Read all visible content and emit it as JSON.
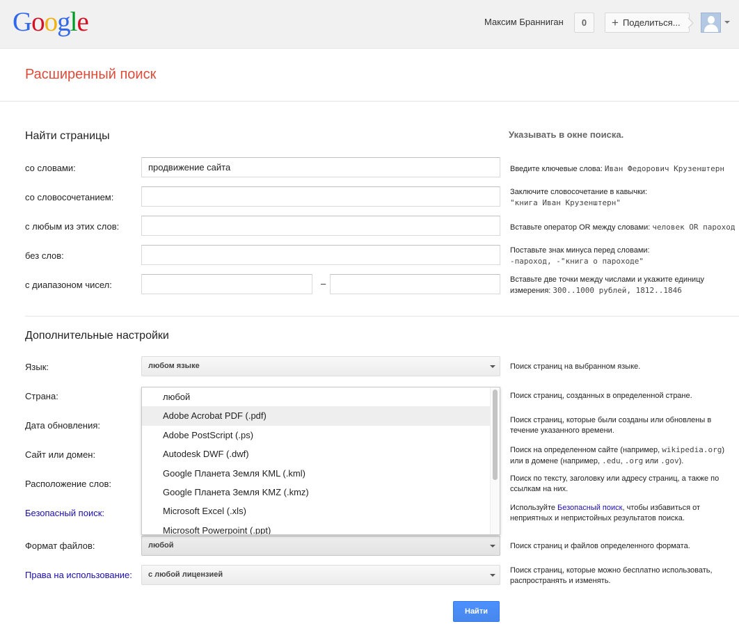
{
  "header": {
    "logo_letters": [
      {
        "ch": "G",
        "color": "#3369e8"
      },
      {
        "ch": "o",
        "color": "#d50f25"
      },
      {
        "ch": "o",
        "color": "#eeb211"
      },
      {
        "ch": "g",
        "color": "#3369e8"
      },
      {
        "ch": "l",
        "color": "#009925"
      },
      {
        "ch": "e",
        "color": "#d50f25"
      }
    ],
    "user_name": "Максим Бранниган",
    "notification_count": "0",
    "share_label": "Поделиться..."
  },
  "page_title": "Расширенный поиск",
  "find_pages": {
    "title": "Найти страницы",
    "hint_header": "Указывать в окне поиска.",
    "fields": [
      {
        "label": "со словами:",
        "value": "продвижение сайта",
        "hint_text": "Введите ключевые слова: ",
        "hint_mono": "Иван Федорович Крузенштерн"
      },
      {
        "label": "со словосочетанием:",
        "value": "",
        "hint_text": "Заключите словосочетание в кавычки:",
        "hint_mono": "\"книга Иван Крузенштерн\""
      },
      {
        "label": "с любым из этих слов:",
        "value": "",
        "hint_text": "Вставьте оператор OR между словами: ",
        "hint_mono": "человек OR пароход"
      },
      {
        "label": "без слов:",
        "value": "",
        "hint_text": "Поставьте знак минуса перед словами:",
        "hint_mono": "-пароход, -\"книга о пароходе\""
      },
      {
        "label": "с диапазоном чисел:",
        "value_from": "",
        "value_to": "",
        "dash": "–",
        "hint_text": "Вставьте две точки между числами и укажите единицу измерения: ",
        "hint_mono": "300..1000 рублей, 1812..1846"
      }
    ]
  },
  "advanced": {
    "title": "Дополнительные настройки",
    "rows": [
      {
        "label": "Язык:",
        "value": "любом языке",
        "hint": "Поиск страниц на выбранном языке."
      },
      {
        "label": "Страна:",
        "hint": "Поиск страниц, созданных в определенной стране."
      },
      {
        "label": "Дата обновления:",
        "hint": "Поиск страниц, которые были созданы или обновлены в течение указанного времени."
      },
      {
        "label": "Сайт или домен:",
        "hint_a": "Поиск на определенном сайте (например, ",
        "hint_mono_a": "wikipedia.org",
        "hint_b": ") или в домене (например, ",
        "hint_mono_b": ".edu",
        "hint_c": ", ",
        "hint_mono_c": ".org",
        "hint_d": " или ",
        "hint_mono_d": ".gov",
        "hint_e": ")."
      },
      {
        "label": "Расположение слов:",
        "hint": "Поиск по тексту, заголовку или адресу страниц, а также по ссылкам на них."
      },
      {
        "label": "Безопасный поиск:",
        "hint_a": "Используйте ",
        "hint_link": "Безопасный поиск",
        "hint_b": ", чтобы избавиться от неприятных и непристойных результатов поиска."
      },
      {
        "label": "Формат файлов:",
        "value": "любой",
        "hint": "Поиск страниц и файлов определенного формата."
      },
      {
        "label": "Права на использование:",
        "value": "с любой лицензией",
        "hint": "Поиск страниц, которые можно бесплатно использовать, распространять и изменять."
      }
    ]
  },
  "file_format_dropdown": {
    "options": [
      "любой",
      "Adobe Acrobat PDF (.pdf)",
      "Adobe PostScript (.ps)",
      "Autodesk DWF (.dwf)",
      "Google Планета Земля KML (.kml)",
      "Google Планета Земля KMZ (.kmz)",
      "Microsoft Excel (.xls)",
      "Microsoft Powerpoint (.ppt)"
    ],
    "highlighted_index": 1
  },
  "search_button": "Найти"
}
